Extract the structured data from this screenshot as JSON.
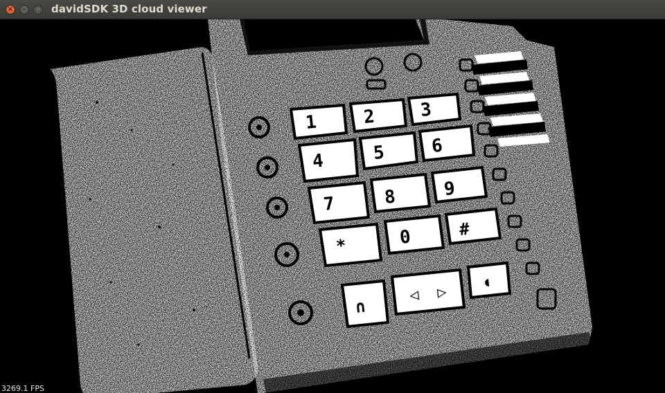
{
  "window": {
    "title": "davidSDK 3D cloud viewer",
    "buttons": [
      "close",
      "minimize",
      "maximize"
    ]
  },
  "viewport": {
    "fps_text": "3269.1 FPS",
    "background": "#000000",
    "point_color": "#ffffff"
  },
  "keypad": {
    "keys": [
      "1",
      "2",
      "3",
      "4",
      "5",
      "6",
      "7",
      "8",
      "9",
      "*",
      "0",
      "#"
    ]
  }
}
